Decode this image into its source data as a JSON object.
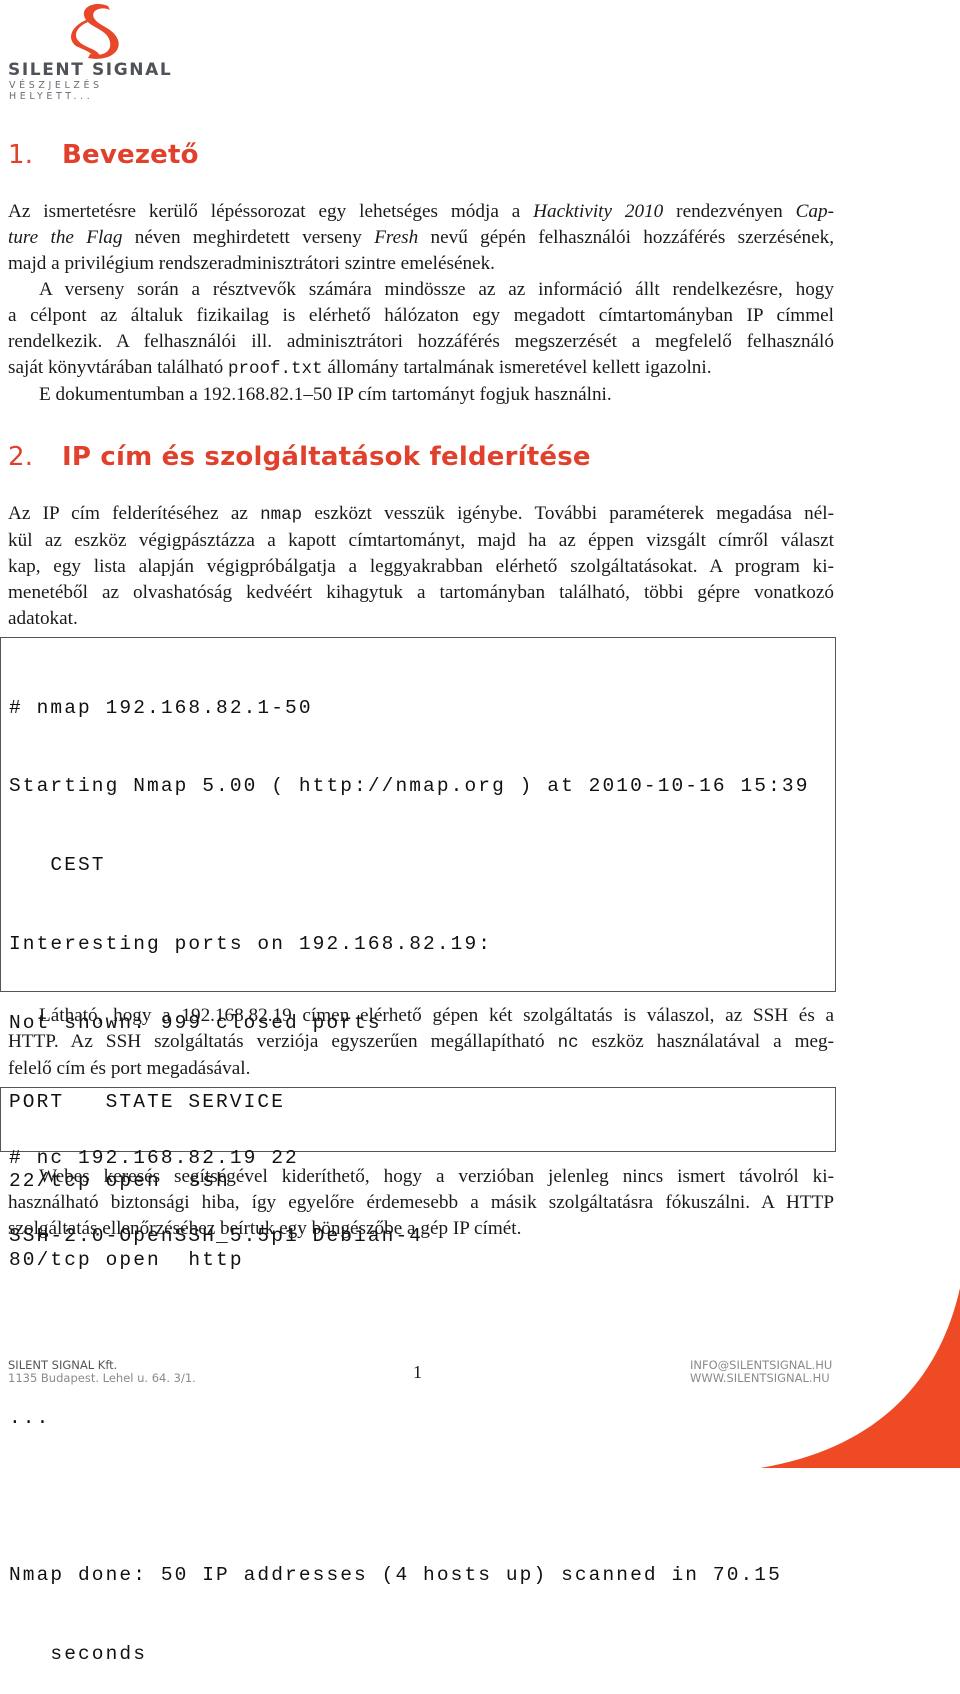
{
  "logo": {
    "name": "SILENT SIGNAL",
    "tagline": "VÉSZJELZÉS HELYETT...",
    "brand_color": "#e8472a"
  },
  "sections": [
    {
      "number": "1.",
      "title": "Bevezető"
    },
    {
      "number": "2.",
      "title": "IP cím és szolgáltatások felderítése"
    }
  ],
  "intro": {
    "p1": [
      [
        "Az ismertetésre kerülő lépéssorozat egy lehetséges módja a ",
        "Hacktivity 2010",
        " rendezvényen ",
        "Cap-"
      ],
      [
        "ture the Flag",
        " néven meghirdetett verseny ",
        "Fresh",
        " nevű gépén felhasználói hozzáférés szerzésének,"
      ],
      [
        "majd a privilégium rendszeradminisztrátori szintre emelésének."
      ]
    ],
    "p2": [
      "A verseny során a résztvevők számára mindössze az az információ állt rendelkezésre, hogy",
      "a célpont az általuk fizikailag is elérhető hálózaton egy megadott címtartományban IP címmel",
      "rendelkezik. A felhasználói ill. adminisztrátori hozzáférés megszerzését a megfelelő felhasználó"
    ],
    "p2_last": [
      "saját könyvtárában található ",
      "proof.txt",
      " állomány tartalmának ismeretével kellett igazolni."
    ],
    "p3": "E dokumentumban a 192.168.82.1–50 IP cím tartományt fogjuk használni."
  },
  "recon": {
    "p1_first": [
      "Az IP cím felderítéséhez az ",
      "nmap",
      " eszközt vesszük igénybe. További paraméterek megadása nél-"
    ],
    "p1_lines": [
      "kül az eszköz végigpásztázza a kapott címtartományt, majd ha az éppen vizsgált címről választ",
      "kap, egy lista alapján végigpróbálgatja a leggyakrabban elérhető szolgáltatásokat. A program ki-",
      "menetéből az olvashatóság kedvéért kihagytuk a tartományban található, többi gépre vonatkozó"
    ],
    "p1_last": "adatokat.",
    "nmap_output": [
      "# nmap 192.168.82.1-50",
      "Starting Nmap 5.00 ( http://nmap.org ) at 2010-10-16 15:39",
      "   CEST",
      "Interesting ports on 192.168.82.19:",
      "Not shown: 999 closed ports",
      "PORT   STATE SERVICE",
      "22/tcp open  ssh",
      "80/tcp open  http",
      "",
      "...",
      "",
      "Nmap done: 50 IP addresses (4 hosts up) scanned in 70.15",
      "   seconds"
    ],
    "p2_first": "Látható, hogy a 192.168.82.19 címen elérhető gépen két szolgáltatás is válaszol, az SSH és a",
    "p2_second": [
      "HTTP. Az SSH szolgáltatás verziója egyszerűen megállapítható ",
      "nc",
      " eszköz használatával a meg-"
    ],
    "p2_last": "felelő cím és port megadásával.",
    "nc_output": [
      "# nc 192.168.82.19 22",
      "SSH-2.0-OpenSSH_5.5p1 Debian-4"
    ],
    "p3": [
      "Webes keresés segítségével kideríthető, hogy a verzióban jelenleg nincs ismert távolról ki-",
      "használható biztonsági hiba, így egyelőre érdemesebb a másik szolgáltatásra fókuszálni. A HTTP"
    ],
    "p3_last": "szolgáltatás ellenőrzéséhez beírtuk egy böngészőbe a gép IP címét."
  },
  "footer": {
    "company": "SILENT SIGNAL Kft.",
    "address": "1135 Budapest. Lehel u. 64. 3/1.",
    "page_number": "1",
    "email": "INFO@SILENTSIGNAL.HU",
    "website": "WWW.SILENTSIGNAL.HU"
  }
}
